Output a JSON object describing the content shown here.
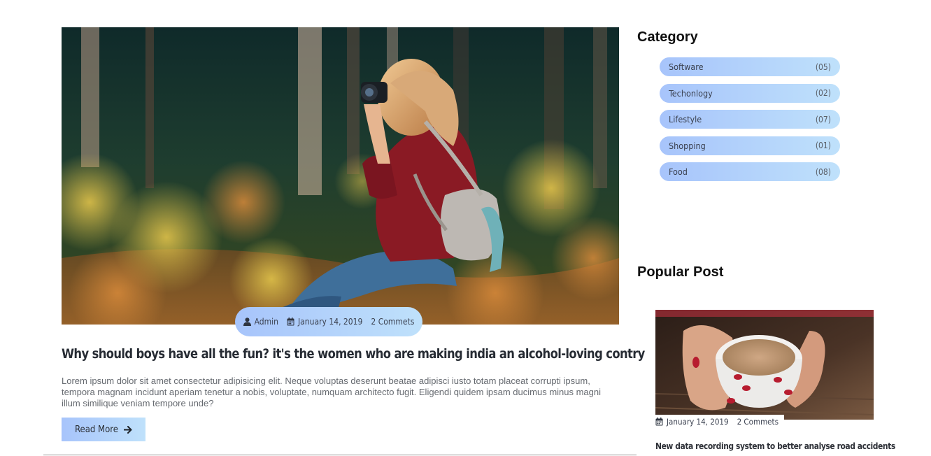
{
  "article": {
    "author": "Admin",
    "date": "January 14, 2019",
    "comments": "2 Commets",
    "title": "Why should boys have all the fun? it's the women who are making india an alcohol-loving contry",
    "excerpt": "Lorem ipsum dolor sit amet consectetur adipisicing elit. Neque voluptas deserunt beatae adipisci iusto totam placeat corrupti ipsum, tempora magnam incidunt aperiam tenetur a nobis, voluptate, numquam architecto fugit. Eligendi quidem ipsam ducimus minus magni illum similique veniam tempore unde?",
    "read_more_label": "Read More",
    "icons": [
      "user-icon",
      "calendar-icon",
      "arrow-right-icon"
    ]
  },
  "sidebar": {
    "category_heading": "Category",
    "categories": [
      {
        "label": "Software",
        "count": "(05)"
      },
      {
        "label": "Techonlogy",
        "count": "(02)"
      },
      {
        "label": "Lifestyle",
        "count": "(07)"
      },
      {
        "label": "Shopping",
        "count": "(01)"
      },
      {
        "label": "Food",
        "count": "(08)"
      }
    ],
    "popular_heading": "Popular Post",
    "popular_post": {
      "date": "January 14, 2019",
      "comments": "2 Commets",
      "title": "New data recording system to better analyse road accidents"
    }
  },
  "colors": {
    "pill_gradient_start": "#a7c4fb",
    "pill_gradient_end": "#bfe1fb",
    "heading": "#111111",
    "body_text": "#666a70"
  }
}
